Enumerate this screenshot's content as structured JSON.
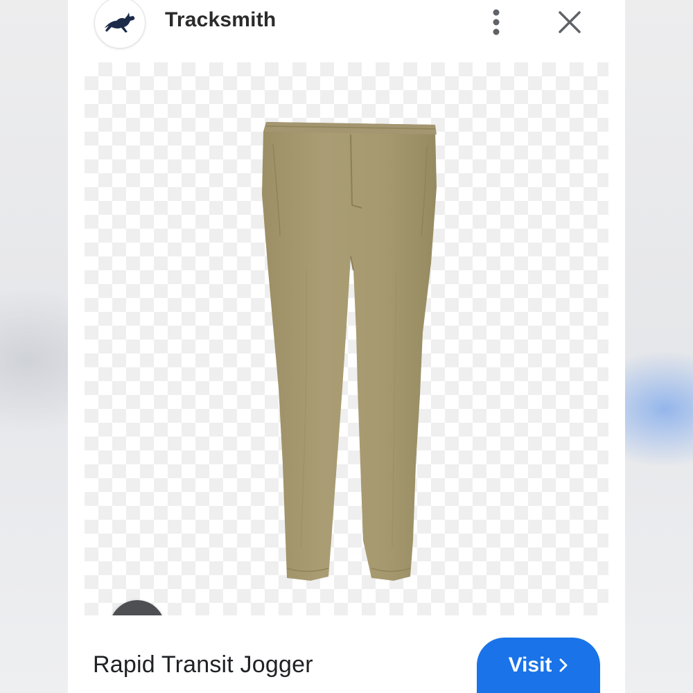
{
  "header": {
    "site_name": "Tracksmith",
    "logo_icon": "running-hare-icon",
    "more_icon": "more-vert-icon",
    "close_icon": "close-icon"
  },
  "image": {
    "subject": "khaki jogger pants",
    "background": "transparency-checkerboard",
    "product_color": "#a79a70"
  },
  "lens": {
    "icon": "google-lens-icon"
  },
  "product": {
    "title": "Rapid Transit Jogger"
  },
  "visit_button": {
    "label": "Visit",
    "icon": "chevron-right-icon",
    "color": "#1a73e8"
  }
}
